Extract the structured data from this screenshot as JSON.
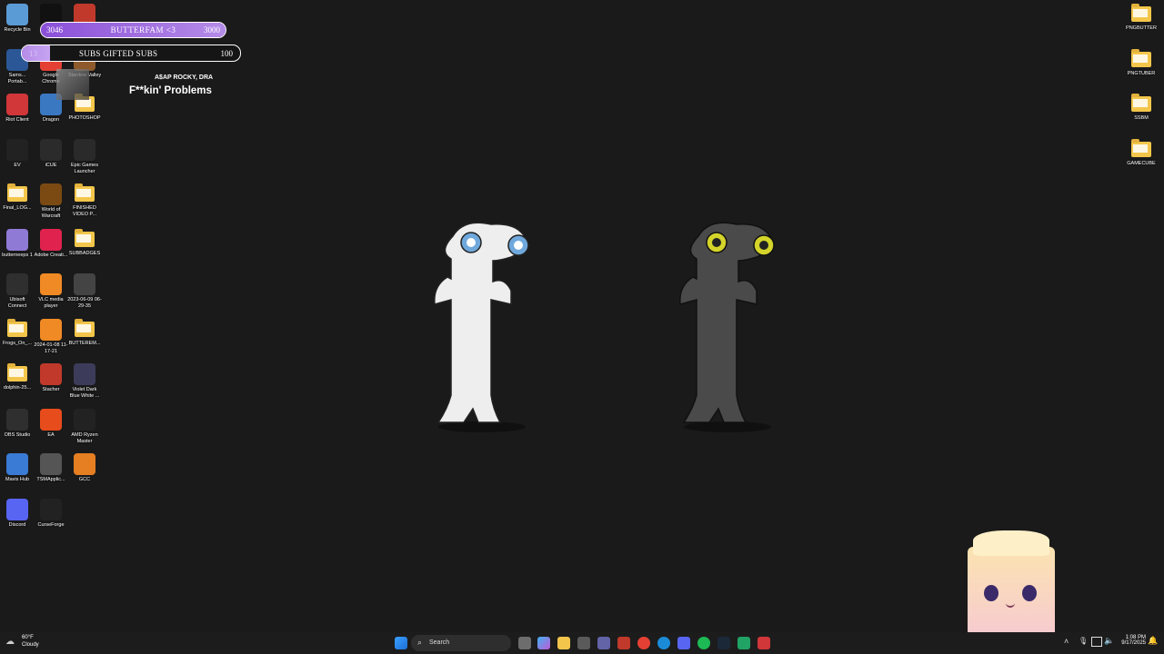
{
  "desktop": {
    "left_icons": [
      {
        "label": "Recycle Bin",
        "icon": "recycle-bin-icon",
        "color": "#5b9bd5"
      },
      {
        "label": "CapCut",
        "icon": "capcut-icon",
        "color": "#111111"
      },
      {
        "label": "Affinity",
        "icon": "affinity-icon",
        "color": "#c0392b"
      },
      {
        "label": "Sams... Portab...",
        "icon": "samsung-icon",
        "color": "#2b5797"
      },
      {
        "label": "Google Chrome",
        "icon": "chrome-icon",
        "color": "#e44134"
      },
      {
        "label": "Stardew Valley",
        "icon": "stardew-icon",
        "color": "#8e5a2b"
      },
      {
        "label": "Riot Client",
        "icon": "riot-icon",
        "color": "#d13639"
      },
      {
        "label": "Dragon",
        "icon": "dragon-icon",
        "color": "#3a78c2"
      },
      {
        "label": "PHOTOSHOP",
        "icon": "folder-icon",
        "color": "#f3c64b"
      },
      {
        "label": "EV",
        "icon": "ev-icon",
        "color": "#222222"
      },
      {
        "label": "iCUE",
        "icon": "icue-icon",
        "color": "#2b2b2b"
      },
      {
        "label": "Epic Games Launcher",
        "icon": "epic-icon",
        "color": "#2a2a2a"
      },
      {
        "label": "Final_LOG...",
        "icon": "folder-icon",
        "color": "#f3c64b"
      },
      {
        "label": "World of Warcraft",
        "icon": "wow-icon",
        "color": "#7a4a12"
      },
      {
        "label": "FINISHED VIDEO P...",
        "icon": "folder-icon",
        "color": "#f3c64b"
      },
      {
        "label": "butterneeps 1",
        "icon": "image-icon",
        "color": "#8f7bd6"
      },
      {
        "label": "Adobe Creati...",
        "icon": "adobe-icon",
        "color": "#e0234e"
      },
      {
        "label": "SUBBADGES",
        "icon": "folder-icon",
        "color": "#f3c64b"
      },
      {
        "label": "Ubisoft Connect",
        "icon": "ubisoft-icon",
        "color": "#2f2f2f"
      },
      {
        "label": "VLC media player",
        "icon": "vlc-icon",
        "color": "#f08a24"
      },
      {
        "label": "2023-06-09 06-29-35",
        "icon": "video-file-icon",
        "color": "#444444"
      },
      {
        "label": "Frogs_On_...",
        "icon": "folder-icon",
        "color": "#f3c64b"
      },
      {
        "label": "2024-01-08 11-17-21",
        "icon": "vlc-icon",
        "color": "#f08a24"
      },
      {
        "label": "BUTTEREM...",
        "icon": "folder-icon",
        "color": "#f3c64b"
      },
      {
        "label": "dolphin-25...",
        "icon": "folder-icon",
        "color": "#f3c64b"
      },
      {
        "label": "Stacher",
        "icon": "stacher-icon",
        "color": "#c0392b"
      },
      {
        "label": "Violet Dark Blue White ...",
        "icon": "image-icon",
        "color": "#3c3c5a"
      },
      {
        "label": "OBS Studio",
        "icon": "obs-icon",
        "color": "#2f2f2f"
      },
      {
        "label": "EA",
        "icon": "ea-icon",
        "color": "#e74c1c"
      },
      {
        "label": "AMD Ryzen Master",
        "icon": "amd-icon",
        "color": "#222222"
      },
      {
        "label": "Mavis Hub",
        "icon": "mavis-icon",
        "color": "#3a7bd5"
      },
      {
        "label": "TSMApplic...",
        "icon": "gear-icon",
        "color": "#555555"
      },
      {
        "label": "GCC",
        "icon": "gcc-icon",
        "color": "#e67e22"
      },
      {
        "label": "Discord",
        "icon": "discord-icon",
        "color": "#5865f2"
      },
      {
        "label": "CurseForge",
        "icon": "curseforge-icon",
        "color": "#222222"
      }
    ],
    "right_icons": [
      {
        "label": "PNGBUTTER"
      },
      {
        "label": "PNGTUBER"
      },
      {
        "label": "SSBM"
      },
      {
        "label": "GAMECUBE"
      }
    ]
  },
  "overlay": {
    "goal1": {
      "current": "3046",
      "title": "BUTTERFAM <3",
      "target": "3000",
      "fill": 1.0
    },
    "goal2": {
      "current": "13",
      "title": "SUBS GIFTED SUBS",
      "target": "100",
      "fill": 0.13
    },
    "now_playing": {
      "artist": "A$AP ROCKY, DRA",
      "song": "F**kin' Problems"
    }
  },
  "characters": [
    {
      "name": "white-character",
      "body": "#eeeeee",
      "eye": "#6fa8dc"
    },
    {
      "name": "dark-character",
      "body": "#4a4a4a",
      "eye": "#d4d42a"
    }
  ],
  "taskbar": {
    "weather_temp": "60°F",
    "weather_desc": "Cloudy",
    "search_placeholder": "Search",
    "time": "1:08 PM",
    "date": "9/17/2025"
  },
  "colors": {
    "desktop_bg": "#1a1a1a",
    "goal_fill": "#b58ce8",
    "taskbar_bg": "#1c1c1c"
  }
}
